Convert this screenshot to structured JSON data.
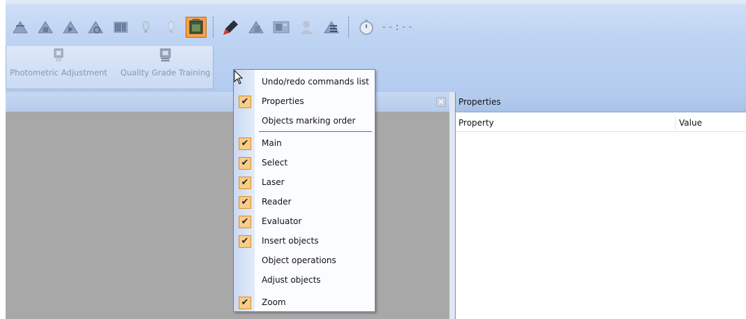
{
  "toolbar": {
    "timer_text": "--:--",
    "buttons": [
      {
        "icon": "select-arrow-icon"
      },
      {
        "icon": "move-tool-icon"
      },
      {
        "icon": "play-tool-icon"
      },
      {
        "icon": "rotate-tool-icon"
      },
      {
        "icon": "barcode-tool-icon"
      },
      {
        "icon": "bulb-off-icon"
      },
      {
        "icon": "bulb-off-icon-2"
      },
      {
        "icon": "camera-active-icon"
      },
      {
        "icon": "laser-pen-icon"
      },
      {
        "icon": "grade-tool-icon"
      },
      {
        "icon": "image-panel-icon"
      },
      {
        "icon": "user-icon"
      },
      {
        "icon": "list-tool-icon"
      },
      {
        "icon": "stopwatch-icon"
      }
    ]
  },
  "ribbon": {
    "photometric_label": "Photometric Adjustment",
    "quality_label": "Quality Grade Training"
  },
  "properties_panel": {
    "title": "Properties",
    "col_property": "Property",
    "col_value": "Value"
  },
  "context_menu": {
    "items": [
      {
        "label": "Undo/redo commands list",
        "checked": false
      },
      {
        "label": "Properties",
        "checked": true
      },
      {
        "label": "Objects marking order",
        "checked": false
      },
      {
        "label": "Main",
        "checked": true
      },
      {
        "label": "Select",
        "checked": true
      },
      {
        "label": "Laser",
        "checked": true
      },
      {
        "label": "Reader",
        "checked": true
      },
      {
        "label": "Evaluator",
        "checked": true
      },
      {
        "label": "Insert objects",
        "checked": true
      },
      {
        "label": "Object operations",
        "checked": false
      },
      {
        "label": "Adjust objects",
        "checked": false
      },
      {
        "label": "Zoom",
        "checked": true
      }
    ],
    "check_glyph": "✔"
  },
  "colors": {
    "toolbar_bg": "#bfd4f3",
    "active_button": "#f6a24a",
    "check_bg": "#f7cd88",
    "workspace_gray": "#a8a8a8"
  }
}
